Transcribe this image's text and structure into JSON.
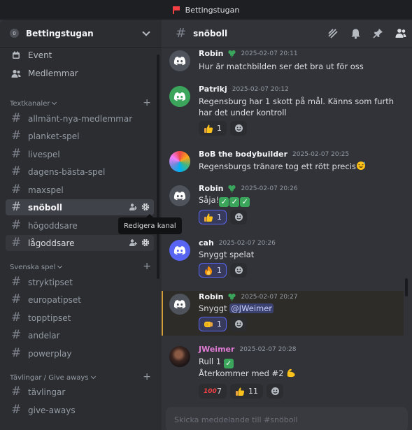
{
  "window": {
    "title": "Bettingstugan"
  },
  "server": {
    "name": "Bettingstugan",
    "badge": "0"
  },
  "nav": [
    {
      "label": "Event",
      "icon": "calendar-icon"
    },
    {
      "label": "Medlemmar",
      "icon": "members-icon"
    }
  ],
  "categories": [
    {
      "label": "Textkanaler",
      "channels": [
        "allmänt-nya-medlemmar",
        "planket-spel",
        "livespel",
        "dagens-bästa-spel",
        "maxspel",
        "snöboll",
        "högoddsare",
        "lågoddsare"
      ]
    },
    {
      "label": "Svenska spel",
      "channels": [
        "stryktipset",
        "europatipset",
        "topptipset",
        "andelar",
        "powerplay"
      ]
    },
    {
      "label": "Tävlingar / Give aways",
      "channels": [
        "tävlingar",
        "give-aways"
      ]
    }
  ],
  "active_channel": "snöboll",
  "tooltip": "Redigera kanal",
  "chat": {
    "channel": "snöboll",
    "header_icons": [
      "threads-icon",
      "bell-icon",
      "pin-icon",
      "members-list-icon"
    ],
    "messages": [
      {
        "author": "Robin",
        "time": "2025-02-07 20:11",
        "lines": [
          "Hur är matchbilden ser det bra ut för oss"
        ],
        "reactions": []
      },
      {
        "author": "Patrikj",
        "time": "2025-02-07 20:12",
        "lines": [
          "Regensburg har 1 skott på mål. Känns som furth",
          "har det under kontroll"
        ],
        "reactions": [
          {
            "emoji": "thumbs-up",
            "count": "1"
          }
        ]
      },
      {
        "author": "BoB the bodybuilder",
        "time": "2025-02-07 20:25",
        "lines": [
          "Regensburgs tränare tog ett rött precis"
        ],
        "reactions": []
      },
      {
        "author": "Robin",
        "time": "2025-02-07 20:26",
        "lines": [
          "Såja!"
        ],
        "reactions": [
          {
            "emoji": "thumbs-up",
            "count": "1"
          }
        ]
      },
      {
        "author": "cah",
        "time": "2025-02-07 20:26",
        "lines": [
          "Snyggt spelat"
        ],
        "reactions": [
          {
            "emoji": "fire",
            "count": "1"
          }
        ]
      },
      {
        "author": "Robin",
        "time": "2025-02-07 20:27",
        "lines": [
          "Snyggt"
        ],
        "mention": "@JWeimer",
        "reactions": [
          {
            "emoji": "fist",
            "count": "1"
          }
        ]
      },
      {
        "author": "JWeimer",
        "time": "2025-02-07 20:28",
        "lines": [
          "Rull 1",
          "Återkommer med #2"
        ],
        "reactions": [
          {
            "emoji": "hundred",
            "count": "7"
          },
          {
            "emoji": "thumbs-up",
            "count": "11"
          }
        ]
      }
    ]
  },
  "composer": {
    "placeholder": "Skicka meddelande till #snöboll"
  },
  "colors": {
    "accent": "#5865f2",
    "highlight_bar": "#d29d3a",
    "active_channel_bg": "#404249"
  }
}
